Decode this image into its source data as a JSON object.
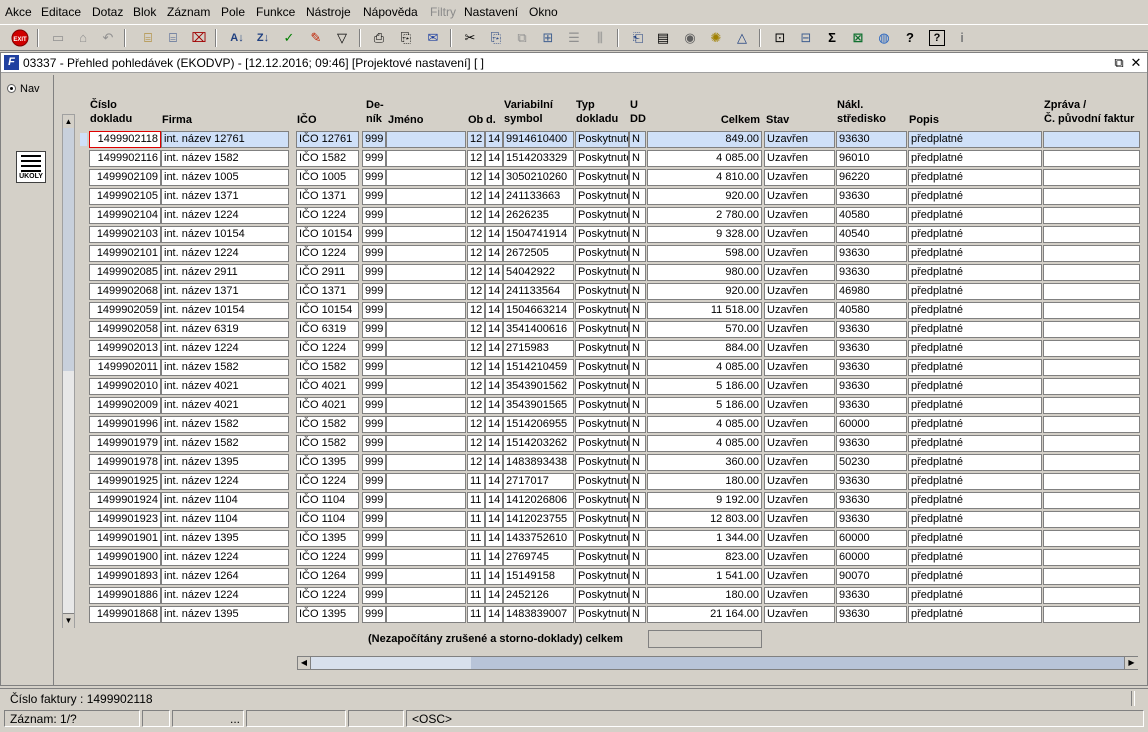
{
  "menu": [
    "Akce",
    "Editace",
    "Dotaz",
    "Blok",
    "Záznam",
    "Pole",
    "Funkce",
    "Nástroje",
    "Nápověda",
    "Filtry",
    "Nastavení",
    "Okno"
  ],
  "menu_disabled": "Filtry",
  "window": {
    "title": "03337 - Přehled pohledávek (EKODVP) - [12.12.2016; 09:46]  [Projektové nastavení]  [ ]"
  },
  "left": {
    "nav_label": "Nav",
    "tasks_label": "ÚKOLY"
  },
  "columns": {
    "cislo_1": "Číslo",
    "cislo_2": "dokladu",
    "firma": "Firma",
    "ico": "IČO",
    "denik_1": "De-",
    "denik_2": "ník",
    "jmeno": "Jméno",
    "ob": "Ob",
    "d": "d.",
    "vs_1": "Variabilní",
    "vs_2": "symbol",
    "typ_1": "Typ",
    "typ_2": "dokladu",
    "u_1": "U",
    "u_2": "DD",
    "celkem": "Celkem",
    "stav": "Stav",
    "nakl_1": "Nákl.",
    "nakl_2": "středisko",
    "popis": "Popis",
    "zprava_1": "Zpráva /",
    "zprava_2": "Č. původní faktur"
  },
  "rows": [
    {
      "doklad": "1499902118",
      "firma": "int. název 12761",
      "ico": "IČO 12761",
      "denik": "999",
      "jmeno": "",
      "ob": "12",
      "d": "14",
      "vs": "9914610400",
      "typ": "Poskytnuté",
      "u": "N",
      "celkem": "849.00",
      "stav": "Uzavřen",
      "str": "93630",
      "popis": "předplatné",
      "zprava": ""
    },
    {
      "doklad": "1499902116",
      "firma": "int. název 1582",
      "ico": "IČO 1582",
      "denik": "999",
      "jmeno": "",
      "ob": "12",
      "d": "14",
      "vs": "1514203329",
      "typ": "Poskytnuté",
      "u": "N",
      "celkem": "4 085.00",
      "stav": "Uzavřen",
      "str": "96010",
      "popis": "předplatné",
      "zprava": ""
    },
    {
      "doklad": "1499902109",
      "firma": "int. název 1005",
      "ico": "IČO 1005",
      "denik": "999",
      "jmeno": "",
      "ob": "12",
      "d": "14",
      "vs": "3050210260",
      "typ": "Poskytnuté",
      "u": "N",
      "celkem": "4 810.00",
      "stav": "Uzavřen",
      "str": "96220",
      "popis": "předplatné",
      "zprava": ""
    },
    {
      "doklad": "1499902105",
      "firma": "int. název 1371",
      "ico": "IČO 1371",
      "denik": "999",
      "jmeno": "",
      "ob": "12",
      "d": "14",
      "vs": "241133663",
      "typ": "Poskytnuté",
      "u": "N",
      "celkem": "920.00",
      "stav": "Uzavřen",
      "str": "93630",
      "popis": "předplatné",
      "zprava": ""
    },
    {
      "doklad": "1499902104",
      "firma": "int. název 1224",
      "ico": "IČO 1224",
      "denik": "999",
      "jmeno": "",
      "ob": "12",
      "d": "14",
      "vs": "2626235",
      "typ": "Poskytnuté",
      "u": "N",
      "celkem": "2 780.00",
      "stav": "Uzavřen",
      "str": "40580",
      "popis": "předplatné",
      "zprava": ""
    },
    {
      "doklad": "1499902103",
      "firma": "int. název 10154",
      "ico": "IČO 10154",
      "denik": "999",
      "jmeno": "",
      "ob": "12",
      "d": "14",
      "vs": "1504741914",
      "typ": "Poskytnuté",
      "u": "N",
      "celkem": "9 328.00",
      "stav": "Uzavřen",
      "str": "40540",
      "popis": "předplatné",
      "zprava": ""
    },
    {
      "doklad": "1499902101",
      "firma": "int. název 1224",
      "ico": "IČO 1224",
      "denik": "999",
      "jmeno": "",
      "ob": "12",
      "d": "14",
      "vs": "2672505",
      "typ": "Poskytnuté",
      "u": "N",
      "celkem": "598.00",
      "stav": "Uzavřen",
      "str": "93630",
      "popis": "předplatné",
      "zprava": ""
    },
    {
      "doklad": "1499902085",
      "firma": "int. název 2911",
      "ico": "IČO 2911",
      "denik": "999",
      "jmeno": "",
      "ob": "12",
      "d": "14",
      "vs": "54042922",
      "typ": "Poskytnuté",
      "u": "N",
      "celkem": "980.00",
      "stav": "Uzavřen",
      "str": "93630",
      "popis": "předplatné",
      "zprava": ""
    },
    {
      "doklad": "1499902068",
      "firma": "int. název 1371",
      "ico": "IČO 1371",
      "denik": "999",
      "jmeno": "",
      "ob": "12",
      "d": "14",
      "vs": "241133564",
      "typ": "Poskytnuté",
      "u": "N",
      "celkem": "920.00",
      "stav": "Uzavřen",
      "str": "46980",
      "popis": "předplatné",
      "zprava": ""
    },
    {
      "doklad": "1499902059",
      "firma": "int. název 10154",
      "ico": "IČO 10154",
      "denik": "999",
      "jmeno": "",
      "ob": "12",
      "d": "14",
      "vs": "1504663214",
      "typ": "Poskytnuté",
      "u": "N",
      "celkem": "11 518.00",
      "stav": "Uzavřen",
      "str": "40580",
      "popis": "předplatné",
      "zprava": ""
    },
    {
      "doklad": "1499902058",
      "firma": "int. název 6319",
      "ico": "IČO 6319",
      "denik": "999",
      "jmeno": "",
      "ob": "12",
      "d": "14",
      "vs": "3541400616",
      "typ": "Poskytnuté",
      "u": "N",
      "celkem": "570.00",
      "stav": "Uzavřen",
      "str": "93630",
      "popis": "předplatné",
      "zprava": ""
    },
    {
      "doklad": "1499902013",
      "firma": "int. název 1224",
      "ico": "IČO 1224",
      "denik": "999",
      "jmeno": "",
      "ob": "12",
      "d": "14",
      "vs": "2715983",
      "typ": "Poskytnuté",
      "u": "N",
      "celkem": "884.00",
      "stav": "Uzavřen",
      "str": "93630",
      "popis": "předplatné",
      "zprava": ""
    },
    {
      "doklad": "1499902011",
      "firma": "int. název 1582",
      "ico": "IČO 1582",
      "denik": "999",
      "jmeno": "",
      "ob": "12",
      "d": "14",
      "vs": "1514210459",
      "typ": "Poskytnuté",
      "u": "N",
      "celkem": "4 085.00",
      "stav": "Uzavřen",
      "str": "93630",
      "popis": "předplatné",
      "zprava": ""
    },
    {
      "doklad": "1499902010",
      "firma": "int. název 4021",
      "ico": "IČO 4021",
      "denik": "999",
      "jmeno": "",
      "ob": "12",
      "d": "14",
      "vs": "3543901562",
      "typ": "Poskytnuté",
      "u": "N",
      "celkem": "5 186.00",
      "stav": "Uzavřen",
      "str": "93630",
      "popis": "předplatné",
      "zprava": ""
    },
    {
      "doklad": "1499902009",
      "firma": "int. název 4021",
      "ico": "IČO 4021",
      "denik": "999",
      "jmeno": "",
      "ob": "12",
      "d": "14",
      "vs": "3543901565",
      "typ": "Poskytnuté",
      "u": "N",
      "celkem": "5 186.00",
      "stav": "Uzavřen",
      "str": "93630",
      "popis": "předplatné",
      "zprava": ""
    },
    {
      "doklad": "1499901996",
      "firma": "int. název 1582",
      "ico": "IČO 1582",
      "denik": "999",
      "jmeno": "",
      "ob": "12",
      "d": "14",
      "vs": "1514206955",
      "typ": "Poskytnuté",
      "u": "N",
      "celkem": "4 085.00",
      "stav": "Uzavřen",
      "str": "60000",
      "popis": "předplatné",
      "zprava": ""
    },
    {
      "doklad": "1499901979",
      "firma": "int. název 1582",
      "ico": "IČO 1582",
      "denik": "999",
      "jmeno": "",
      "ob": "12",
      "d": "14",
      "vs": "1514203262",
      "typ": "Poskytnuté",
      "u": "N",
      "celkem": "4 085.00",
      "stav": "Uzavřen",
      "str": "93630",
      "popis": "předplatné",
      "zprava": ""
    },
    {
      "doklad": "1499901978",
      "firma": "int. název 1395",
      "ico": "IČO 1395",
      "denik": "999",
      "jmeno": "",
      "ob": "12",
      "d": "14",
      "vs": "1483893438",
      "typ": "Poskytnuté",
      "u": "N",
      "celkem": "360.00",
      "stav": "Uzavřen",
      "str": "50230",
      "popis": "předplatné",
      "zprava": ""
    },
    {
      "doklad": "1499901925",
      "firma": "int. název 1224",
      "ico": "IČO 1224",
      "denik": "999",
      "jmeno": "",
      "ob": "11",
      "d": "14",
      "vs": "2717017",
      "typ": "Poskytnuté",
      "u": "N",
      "celkem": "180.00",
      "stav": "Uzavřen",
      "str": "93630",
      "popis": "předplatné",
      "zprava": ""
    },
    {
      "doklad": "1499901924",
      "firma": "int. název 1104",
      "ico": "IČO 1104",
      "denik": "999",
      "jmeno": "",
      "ob": "11",
      "d": "14",
      "vs": "1412026806",
      "typ": "Poskytnuté",
      "u": "N",
      "celkem": "9 192.00",
      "stav": "Uzavřen",
      "str": "93630",
      "popis": "předplatné",
      "zprava": ""
    },
    {
      "doklad": "1499901923",
      "firma": "int. název 1104",
      "ico": "IČO 1104",
      "denik": "999",
      "jmeno": "",
      "ob": "11",
      "d": "14",
      "vs": "1412023755",
      "typ": "Poskytnuté",
      "u": "N",
      "celkem": "12 803.00",
      "stav": "Uzavřen",
      "str": "93630",
      "popis": "předplatné",
      "zprava": ""
    },
    {
      "doklad": "1499901901",
      "firma": "int. název 1395",
      "ico": "IČO 1395",
      "denik": "999",
      "jmeno": "",
      "ob": "11",
      "d": "14",
      "vs": "1433752610",
      "typ": "Poskytnuté",
      "u": "N",
      "celkem": "1 344.00",
      "stav": "Uzavřen",
      "str": "60000",
      "popis": "předplatné",
      "zprava": ""
    },
    {
      "doklad": "1499901900",
      "firma": "int. název 1224",
      "ico": "IČO 1224",
      "denik": "999",
      "jmeno": "",
      "ob": "11",
      "d": "14",
      "vs": "2769745",
      "typ": "Poskytnuté",
      "u": "N",
      "celkem": "823.00",
      "stav": "Uzavřen",
      "str": "60000",
      "popis": "předplatné",
      "zprava": ""
    },
    {
      "doklad": "1499901893",
      "firma": "int. název 1264",
      "ico": "IČO 1264",
      "denik": "999",
      "jmeno": "",
      "ob": "11",
      "d": "14",
      "vs": "15149158",
      "typ": "Poskytnuté",
      "u": "N",
      "celkem": "1 541.00",
      "stav": "Uzavřen",
      "str": "90070",
      "popis": "předplatné",
      "zprava": ""
    },
    {
      "doklad": "1499901886",
      "firma": "int. název 1224",
      "ico": "IČO 1224",
      "denik": "999",
      "jmeno": "",
      "ob": "11",
      "d": "14",
      "vs": "2452126",
      "typ": "Poskytnuté",
      "u": "N",
      "celkem": "180.00",
      "stav": "Uzavřen",
      "str": "93630",
      "popis": "předplatné",
      "zprava": ""
    },
    {
      "doklad": "1499901868",
      "firma": "int. název 1395",
      "ico": "IČO 1395",
      "denik": "999",
      "jmeno": "",
      "ob": "11",
      "d": "14",
      "vs": "1483839007",
      "typ": "Poskytnuté",
      "u": "N",
      "celkem": "21 164.00",
      "stav": "Uzavřen",
      "str": "93630",
      "popis": "předplatné",
      "zprava": ""
    }
  ],
  "footer": {
    "total_label": "(Nezapočítány zrušené a storno-doklady) celkem",
    "total_value": ""
  },
  "status": {
    "hint": "Číslo faktury : 1499902118",
    "record": "Záznam: 1/?",
    "ellipsis": "...",
    "osc": "<OSC>"
  },
  "colors": {
    "current_row": "#cfe0f8",
    "selected_border": "#e00000",
    "chrome": "#d4d0c8"
  },
  "toolbar_icons": [
    "exit-icon",
    "print-preview-icon",
    "save-icon",
    "undo-icon",
    "query-enter-icon",
    "query-execute-icon",
    "query-cancel-icon",
    "sort-asc-icon",
    "sort-desc-icon",
    "confirm-check-icon",
    "tools-icon",
    "filter-icon",
    "print-icon",
    "print-setup-icon",
    "mail-icon",
    "cut-icon",
    "copy-icon",
    "paste-icon",
    "tree-icon",
    "list-icon",
    "columns-icon",
    "export-icon",
    "document-icon",
    "globe-icon",
    "settings-icon",
    "chart-icon",
    "attach-icon",
    "calc-icon",
    "sum-icon",
    "excel-icon",
    "browser-icon",
    "help-icon",
    "context-help-icon",
    "info-icon"
  ]
}
